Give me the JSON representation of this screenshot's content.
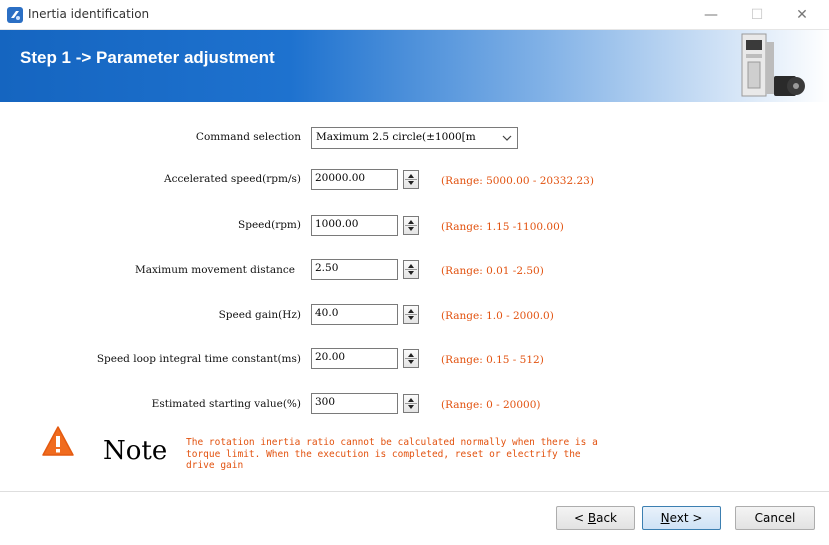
{
  "window": {
    "title": "Inertia identification",
    "min_glyph": "—",
    "max_glyph": "☐",
    "close_glyph": "✕",
    "icon": "app-logo-icon"
  },
  "banner": {
    "title": "Step 1 -> Parameter adjustment",
    "image": "servo-drive-motor-icon"
  },
  "form": {
    "command": {
      "label": "Command selection",
      "value": "Maximum 2.5 circle(±1000[m"
    },
    "rows": [
      {
        "label": "Accelerated speed(rpm/s)",
        "value": "20000.00",
        "range": "(Range: 5000.00 - 20332.23)"
      },
      {
        "label": "Speed(rpm)",
        "value": "1000.00",
        "range": "(Range: 1.15 -1100.00)"
      },
      {
        "label": "Maximum movement distance",
        "value": "2.50",
        "range": "(Range: 0.01 -2.50)"
      },
      {
        "label": "Speed gain(Hz)",
        "value": "40.0",
        "range": "(Range: 1.0 - 2000.0)"
      },
      {
        "label": "Speed loop integral time constant(ms)",
        "value": "20.00",
        "range": "(Range: 0.15 - 512)"
      },
      {
        "label": "Estimated starting value(%)",
        "value": "300",
        "range": "(Range: 0 - 20000)"
      }
    ]
  },
  "note": {
    "title": "Note",
    "line1": "The rotation inertia ratio cannot be calculated normally when there is a",
    "line2": "torque limit. When the execution is completed, reset or electrify the",
    "line3": "drive gain",
    "icon": "warning-triangle-icon"
  },
  "buttons": {
    "back_prefix": "< ",
    "back_key": "B",
    "back_rest": "ack",
    "next_key": "N",
    "next_rest": "ext >",
    "cancel": "Cancel"
  },
  "colors": {
    "banner": "#1565c0",
    "range_text": "#e2520f",
    "warning": "#f06b1e"
  }
}
